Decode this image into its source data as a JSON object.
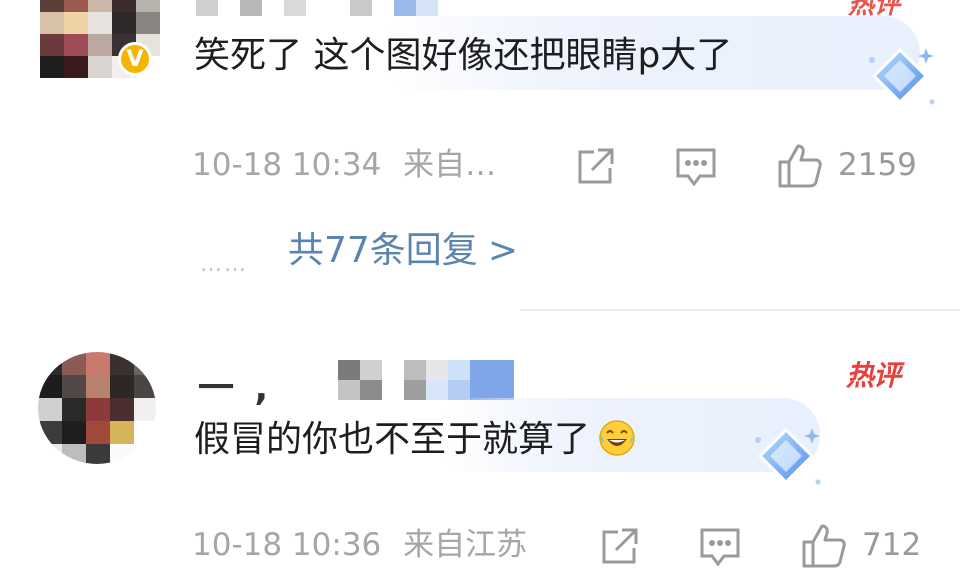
{
  "comments": [
    {
      "text": "笑死了 这个图好像还把眼睛p大了",
      "timestamp": "10-18 10:34",
      "location": "来自…",
      "likes": "2159",
      "verified": true,
      "verified_mark": "V",
      "hot_label": "热评",
      "replies": {
        "dots": "……",
        "label": "共77条回复",
        "chevron": ">"
      }
    },
    {
      "name_visible": "一 ,",
      "text": "假冒的你也不至于就算了",
      "emoji": "tears-of-joy-emoji",
      "timestamp": "10-18 10:36",
      "location": "来自江苏",
      "likes": "712",
      "hot_label": "热评"
    }
  ],
  "icons": {
    "share": "share-icon",
    "reply": "comment-icon",
    "like": "thumbs-up-icon",
    "decoration": "diamond-gem-icon"
  },
  "colors": {
    "text": "#1e1e1e",
    "meta": "#a6a6a6",
    "link": "#5b84b1",
    "hot": "#e8413a",
    "badge": "#f6b400",
    "bubble": "#eef3fd"
  },
  "mosaic": {
    "avatar_1": [
      "#5d3f3a",
      "#9c5a4e",
      "#c9b8a8",
      "#3c2c2c",
      "#b7b2ab",
      "#d7c2a7",
      "#f0d3a5",
      "#e8e3de",
      "#2e2a2a",
      "#8a8480",
      "#6a3a3c",
      "#9e4d56",
      "#bba8a0",
      "#3a3232",
      "#e6e2dc",
      "#1f1f1f",
      "#3a1a1a",
      "#d8d4cf",
      "#f2f0ec",
      "#ffffff"
    ],
    "avatar_2": [
      "#2b2b2b",
      "#8a5a55",
      "#c87a6e",
      "#3b3030",
      "#6a6464",
      "#1d1d1d",
      "#544747",
      "#b7836f",
      "#2e2727",
      "#4a4545",
      "#cfcfcf",
      "#2a2a2a",
      "#8c3a3c",
      "#4b2e2e",
      "#f0eeee",
      "#3c3c3c",
      "#1e1e1e",
      "#a14a3c",
      "#d6b45a",
      "#ffffff",
      "#e9e9e9",
      "#bdbdbd",
      "#3a3a3a",
      "#fafafa",
      "#ffffff"
    ],
    "name_1": [
      "#cfcfcf",
      "#ffffff",
      "#b8b8b8",
      "#ffffff",
      "#d9d9d9",
      "#ffffff",
      "#ffffff",
      "#c9c9c9",
      "#ffffff",
      "#9ab8ea",
      "#d5e3f9"
    ],
    "name_2": [
      "#7a7a7a",
      "#d0d0d0",
      "#ffffff",
      "#bdbdbd",
      "#e6e6e6",
      "#cfe0fa",
      "#7fa6e8",
      "#7fa6e8",
      "#ffffff",
      "#ffffff",
      "#c4c4c4",
      "#8c8c8c",
      "#ffffff",
      "#9e9e9e",
      "#d8e6fb",
      "#b5cdf3",
      "#7fa6e8",
      "#7fa6e8",
      "#ffffff",
      "#ffffff"
    ]
  }
}
